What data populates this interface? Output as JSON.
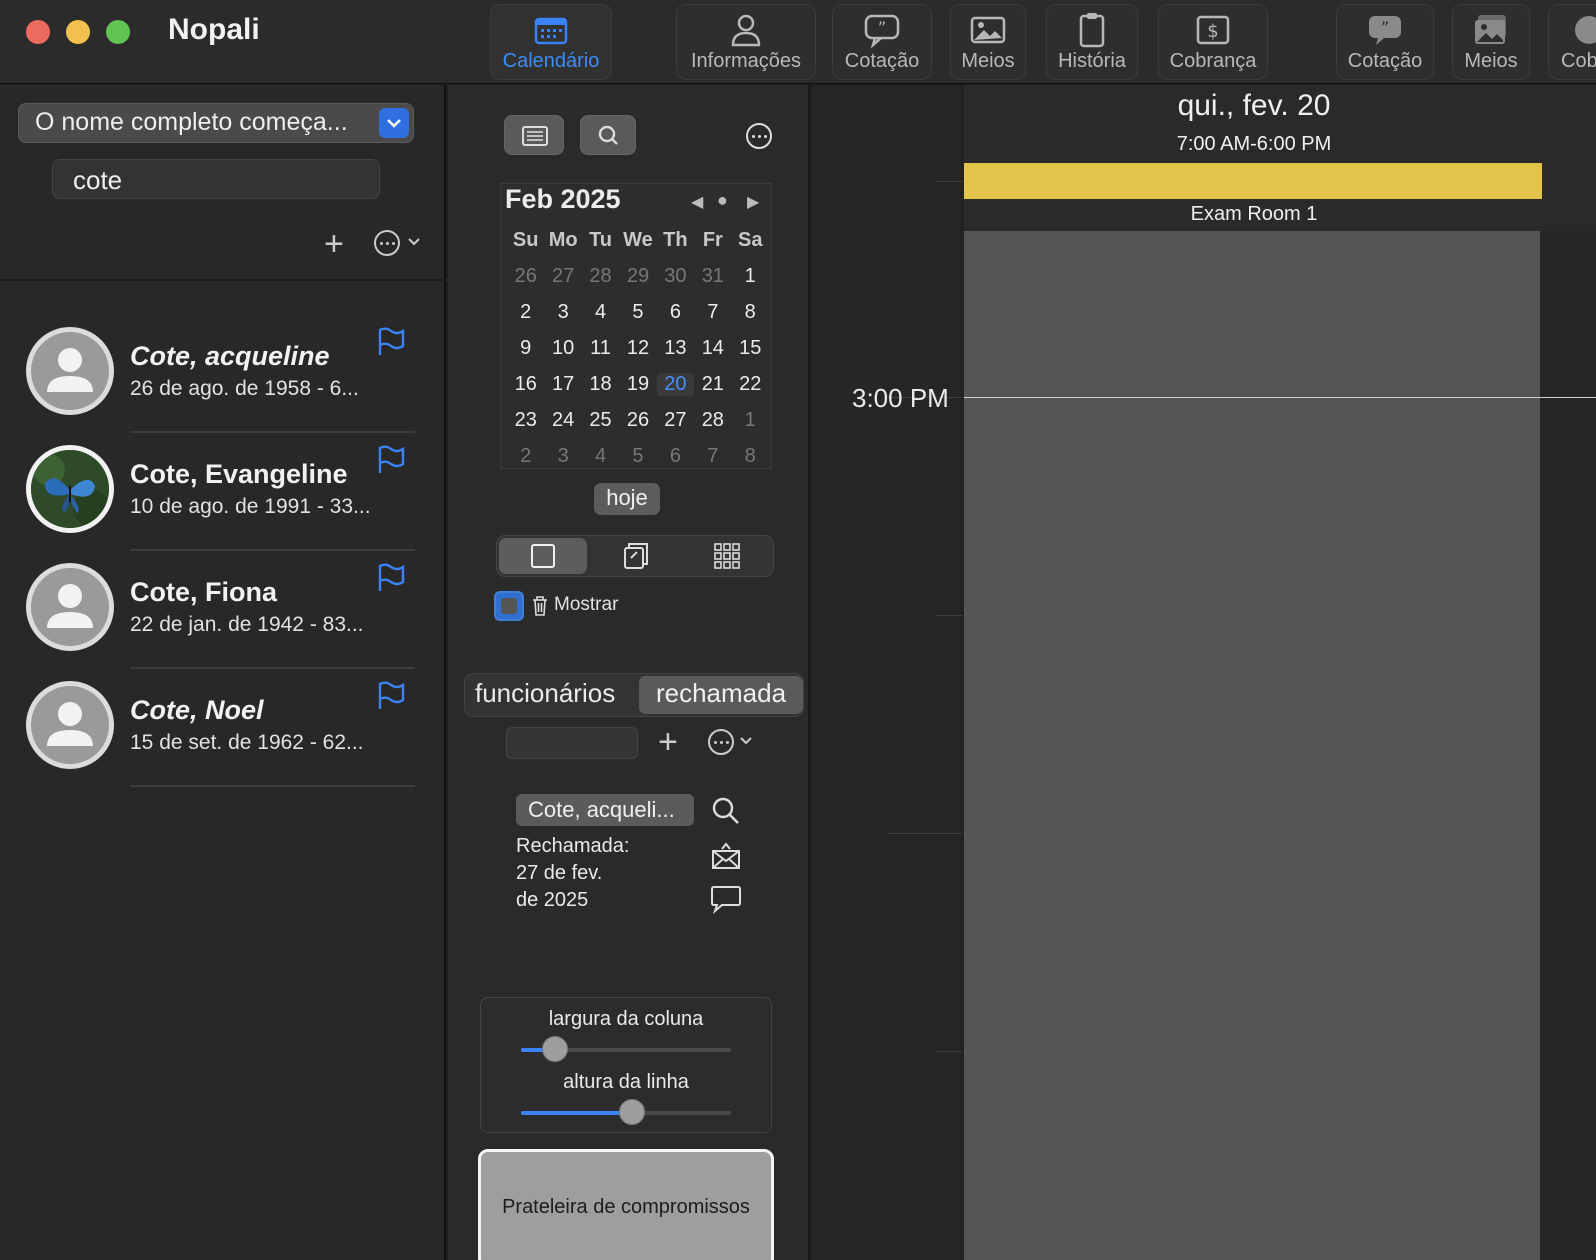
{
  "app": {
    "title": "Nopali"
  },
  "toolbar": {
    "items": [
      {
        "label": "Calendário",
        "icon": "calendar-icon",
        "active": true
      },
      {
        "label": "Informações",
        "icon": "person-icon"
      },
      {
        "label": "Cotação",
        "icon": "quote-icon"
      },
      {
        "label": "Meios",
        "icon": "photo-icon"
      },
      {
        "label": "História",
        "icon": "clipboard-icon"
      },
      {
        "label": "Cobrança",
        "icon": "dollar-icon"
      },
      {
        "label": "Cotação",
        "icon": "quote-icon"
      },
      {
        "label": "Meios",
        "icon": "photos-icon"
      },
      {
        "label": "Cob",
        "icon": "dollar-icon"
      }
    ]
  },
  "left": {
    "filter": {
      "label": "O nome completo começa..."
    },
    "search": {
      "value": "cote"
    },
    "add_symbol": "+",
    "patients": [
      {
        "name": "Cote, acqueline",
        "italic": true,
        "detail": "26 de ago. de 1958 - 6...",
        "avatar": "default"
      },
      {
        "name": "Cote, Evangeline",
        "italic": false,
        "detail": "10 de ago. de 1991 - 33...",
        "avatar": "butterfly-photo"
      },
      {
        "name": "Cote, Fiona",
        "italic": false,
        "detail": "22 de jan. de 1942 - 83...",
        "avatar": "default"
      },
      {
        "name": "Cote, Noel",
        "italic": true,
        "detail": "15 de set. de 1962 - 62...",
        "avatar": "default"
      }
    ]
  },
  "calendar": {
    "title": "Feb 2025",
    "weekdays": [
      "Su",
      "Mo",
      "Tu",
      "We",
      "Th",
      "Fr",
      "Sa"
    ],
    "weeks": [
      [
        "26",
        "27",
        "28",
        "29",
        "30",
        "31",
        "1"
      ],
      [
        "2",
        "3",
        "4",
        "5",
        "6",
        "7",
        "8"
      ],
      [
        "9",
        "10",
        "11",
        "12",
        "13",
        "14",
        "15"
      ],
      [
        "16",
        "17",
        "18",
        "19",
        "20",
        "21",
        "22"
      ],
      [
        "23",
        "24",
        "25",
        "26",
        "27",
        "28",
        "1"
      ],
      [
        "2",
        "3",
        "4",
        "5",
        "6",
        "7",
        "8"
      ]
    ],
    "selected_day": "20",
    "today_button": "hoje"
  },
  "mid": {
    "show_deleted_label": "Mostrar",
    "tabs": {
      "left": "funcionários",
      "right": "rechamada"
    },
    "recall": {
      "patient": "Cote, acqueli...",
      "line1": "Rechamada:",
      "line2": "27 de fev.",
      "line3": "de 2025"
    },
    "sliders": {
      "column_width_label": "largura da coluna",
      "column_width_value": 0.16,
      "row_height_label": "altura da linha",
      "row_height_value": 0.53
    },
    "shelf_label": "Prateleira de compromissos"
  },
  "schedule": {
    "day_title": "qui., fev. 20",
    "hours": "7:00 AM-6:00 PM",
    "room": "Exam Room 1",
    "time_label": "3:00 PM",
    "status_color": "#e1c449"
  }
}
